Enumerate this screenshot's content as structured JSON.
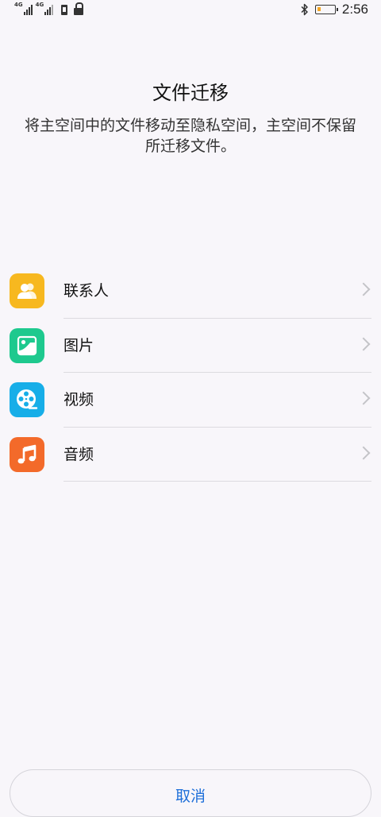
{
  "status_bar": {
    "sim1_network": "4G",
    "sim2_network": "4G",
    "battery_level": 0.2,
    "battery_color": "#f5a623",
    "time": "2:56",
    "icons": [
      "signal-icon",
      "sim-card-icon",
      "lock-icon",
      "bluetooth-icon",
      "battery-icon"
    ]
  },
  "header": {
    "title": "文件迁移",
    "description": "将主空间中的文件移动至隐私空间，主空间不保留所迁移文件。"
  },
  "list": {
    "items": [
      {
        "label": "联系人",
        "icon": "contacts-icon",
        "color": "#f7b81f"
      },
      {
        "label": "图片",
        "icon": "picture-icon",
        "color": "#1ec98e"
      },
      {
        "label": "视频",
        "icon": "video-icon",
        "color": "#17aee8"
      },
      {
        "label": "音频",
        "icon": "music-icon",
        "color": "#f36a2a"
      }
    ]
  },
  "footer": {
    "cancel_label": "取消",
    "accent": "#1e6fd9"
  }
}
